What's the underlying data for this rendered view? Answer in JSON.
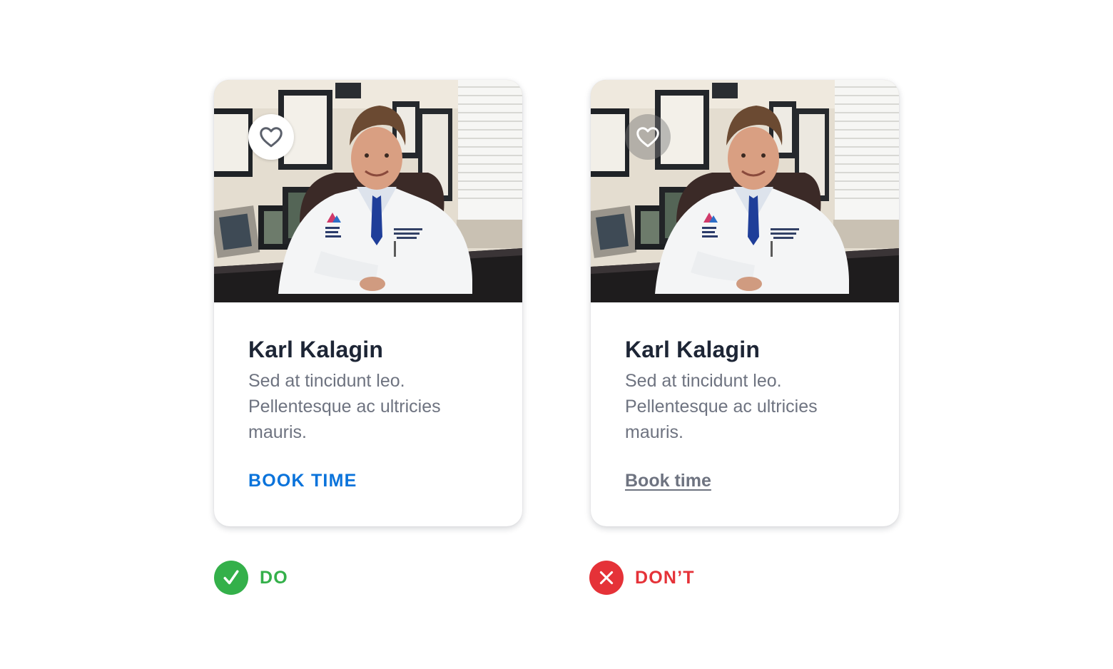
{
  "cards": [
    {
      "variant": "do",
      "favorite_icon": "heart-outline-icon",
      "name": "Karl Kalagin",
      "description": "Sed at tincidunt leo. Pellentesque ac ultricies mauris.",
      "cta_label": "BOOK TIME",
      "cta_color": "#0a73db"
    },
    {
      "variant": "dont",
      "favorite_icon": "heart-outline-icon",
      "name": "Karl Kalagin",
      "description": "Sed at tincidunt leo. Pellentesque ac ultricies mauris.",
      "cta_label": "Book time",
      "cta_color": "#6e7380"
    }
  ],
  "verdicts": {
    "do": {
      "label": "DO",
      "icon": "checkmark-icon",
      "color": "#34b04a"
    },
    "dont": {
      "label": "DON’T",
      "icon": "close-icon",
      "color": "#e53238"
    }
  }
}
